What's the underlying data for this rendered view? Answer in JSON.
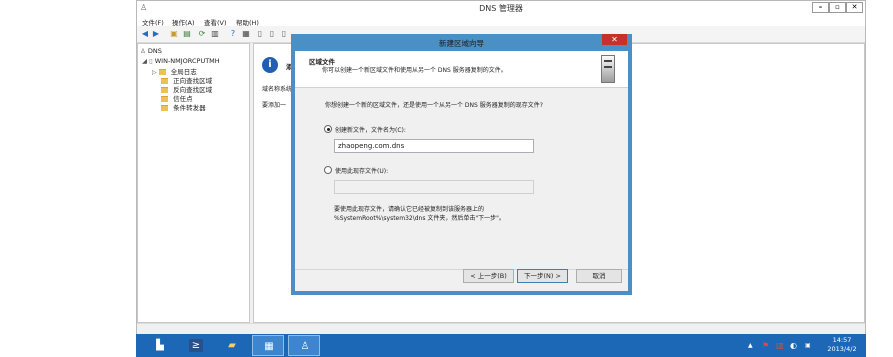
{
  "main_window": {
    "title": "DNS 管理器",
    "controls": {
      "minimize": "–",
      "maximize": "▫",
      "close": "✕"
    },
    "menu": [
      "文件(F)",
      "操作(A)",
      "查看(V)",
      "帮助(H)"
    ],
    "tree": {
      "root": "DNS",
      "server": "WIN-NMJORCPUTMH",
      "children": [
        "全局日志",
        "正向查找区域",
        "反向查找区域",
        "信任点",
        "条件转发器"
      ]
    },
    "right_pane": {
      "heading_partial": "添",
      "line1_partial": "域名称系统",
      "line2_partial": "要添加一"
    }
  },
  "wizard": {
    "title": "新建区域向导",
    "close": "✕",
    "header_title": "区域文件",
    "header_desc": "你可以创建一个新区域文件和使用从另一个 DNS 服务器复制的文件。",
    "question": "你想创建一个新的区域文件，还是使用一个从另一个 DNS 服务器复制的现存文件?",
    "option_new_label": "创建新文件，文件名为(C):",
    "new_file_value": "zhaopeng.com.dns",
    "option_existing_label": "使用此现存文件(U):",
    "existing_file_value": "",
    "note_line1": "要使用此现存文件，请确认它已经被复制到该服务器上的",
    "note_line2": "%SystemRoot%\\system32\\dns 文件夹，然后单击\"下一步\"。",
    "buttons": {
      "back": "< 上一步(B)",
      "next": "下一步(N) >",
      "cancel": "取消"
    }
  },
  "taskbar": {
    "time": "14:57",
    "date": "2013/4/2",
    "tray_arrow": "▲"
  }
}
